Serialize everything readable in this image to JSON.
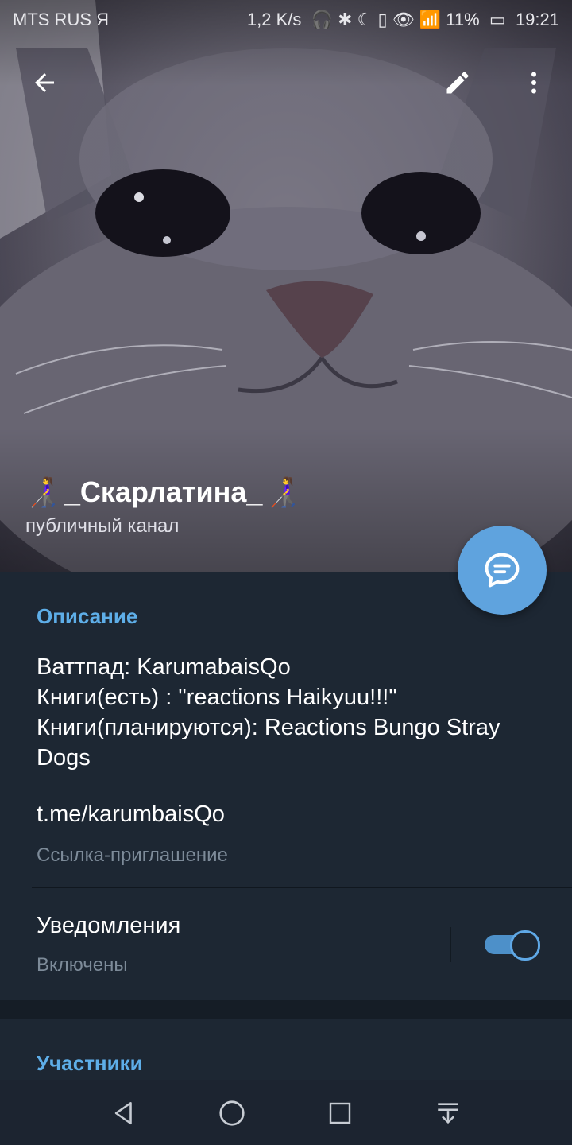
{
  "status_bar": {
    "carrier": "MTS RUS Я",
    "speed": "1,2 K/s",
    "battery": "11%",
    "time": "19:21"
  },
  "header": {
    "back_icon": "arrow-left-icon",
    "edit_icon": "pencil-icon",
    "more_icon": "more-vert-icon"
  },
  "channel": {
    "name": "_Скарлатина_",
    "emoji": "👩‍🦯",
    "type": "публичный канал"
  },
  "description": {
    "section_title": "Описание",
    "text": "Ваттпад: KarumabaisQo\nКниги(есть) : \"reactions Haikyuu!!!\"\nКниги(планируются): Reactions Bungo Stray Dogs",
    "link": "t.me/karumbaisQo",
    "link_caption": "Ссылка-приглашение"
  },
  "notifications": {
    "label": "Уведомления",
    "status": "Включены",
    "enabled": true
  },
  "members": {
    "section_title": "Участники"
  },
  "colors": {
    "background": "#1d2733",
    "accent": "#5eaee8",
    "fab": "#5fa3de"
  }
}
